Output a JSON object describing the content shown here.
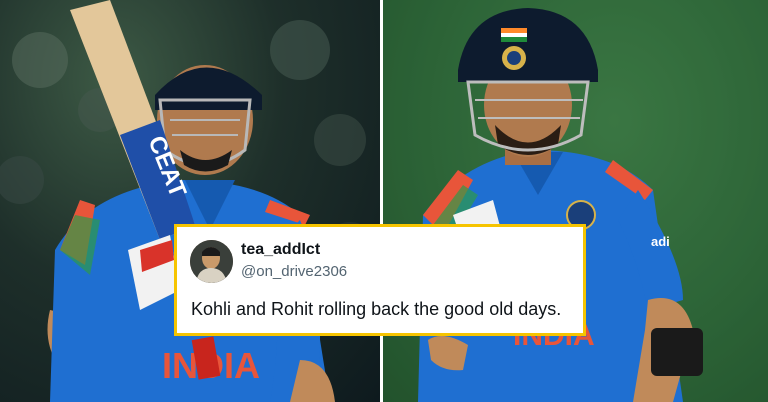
{
  "tweet": {
    "display_name": "tea_addIct",
    "handle": "@on_drive2306",
    "text": "Kohli and Rohit rolling back the good old days."
  },
  "photos": {
    "left": {
      "bat_brand": "CEAT",
      "jersey_text": "INDIA"
    },
    "right": {
      "jersey_text": "INDIA",
      "sleeve_logo": "adi"
    }
  },
  "colors": {
    "card_border": "#f6c400",
    "jersey_blue": "#1f6fd1",
    "jersey_text": "#e8553a"
  }
}
